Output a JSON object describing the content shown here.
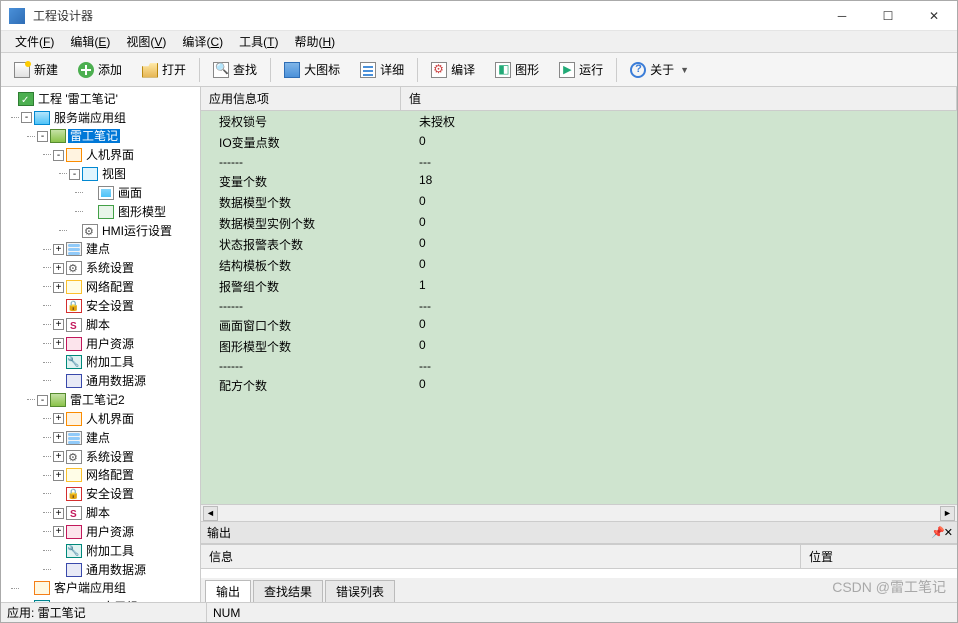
{
  "window": {
    "title": "工程设计器"
  },
  "menus": [
    {
      "label": "文件",
      "hotkey": "F"
    },
    {
      "label": "编辑",
      "hotkey": "E"
    },
    {
      "label": "视图",
      "hotkey": "V"
    },
    {
      "label": "编译",
      "hotkey": "C"
    },
    {
      "label": "工具",
      "hotkey": "T"
    },
    {
      "label": "帮助",
      "hotkey": "H"
    }
  ],
  "toolbar": {
    "new": "新建",
    "add": "添加",
    "open": "打开",
    "find": "查找",
    "large": "大图标",
    "detail": "详细",
    "compile": "编译",
    "shape": "图形",
    "run": "运行",
    "about": "关于"
  },
  "tree": {
    "root": "工程 '雷工笔记'",
    "serverGroup": "服务端应用组",
    "app1": "雷工笔记",
    "hmi": "人机界面",
    "view": "视图",
    "screen": "画面",
    "gmodel": "图形模型",
    "hmiRun": "HMI运行设置",
    "tags": "建点",
    "syscfg": "系统设置",
    "netcfg": "网络配置",
    "seccfg": "安全设置",
    "script": "脚本",
    "userres": "用户资源",
    "addtool": "附加工具",
    "datasrc": "通用数据源",
    "app2": "雷工笔记2",
    "clientGroup": "客户端应用组",
    "ioGroup": "IOServer应用组"
  },
  "info": {
    "headers": {
      "item": "应用信息项",
      "value": "值"
    },
    "rows": [
      {
        "k": "授权锁号",
        "v": "未授权"
      },
      {
        "k": "IO变量点数",
        "v": "0"
      },
      {
        "k": "------",
        "v": "---"
      },
      {
        "k": "变量个数",
        "v": "18"
      },
      {
        "k": "数据模型个数",
        "v": "0"
      },
      {
        "k": "数据模型实例个数",
        "v": "0"
      },
      {
        "k": "状态报警表个数",
        "v": "0"
      },
      {
        "k": "结构模板个数",
        "v": "0"
      },
      {
        "k": "报警组个数",
        "v": "1"
      },
      {
        "k": "------",
        "v": "---"
      },
      {
        "k": "画面窗口个数",
        "v": "0"
      },
      {
        "k": "图形模型个数",
        "v": "0"
      },
      {
        "k": "------",
        "v": "---"
      },
      {
        "k": "配方个数",
        "v": "0"
      }
    ]
  },
  "output": {
    "title": "输出",
    "col1": "信息",
    "col2": "位置",
    "tabs": [
      "输出",
      "查找结果",
      "错误列表"
    ]
  },
  "status": {
    "left": "应用: 雷工笔记",
    "mid": "NUM"
  },
  "watermark": "CSDN @雷工笔记"
}
